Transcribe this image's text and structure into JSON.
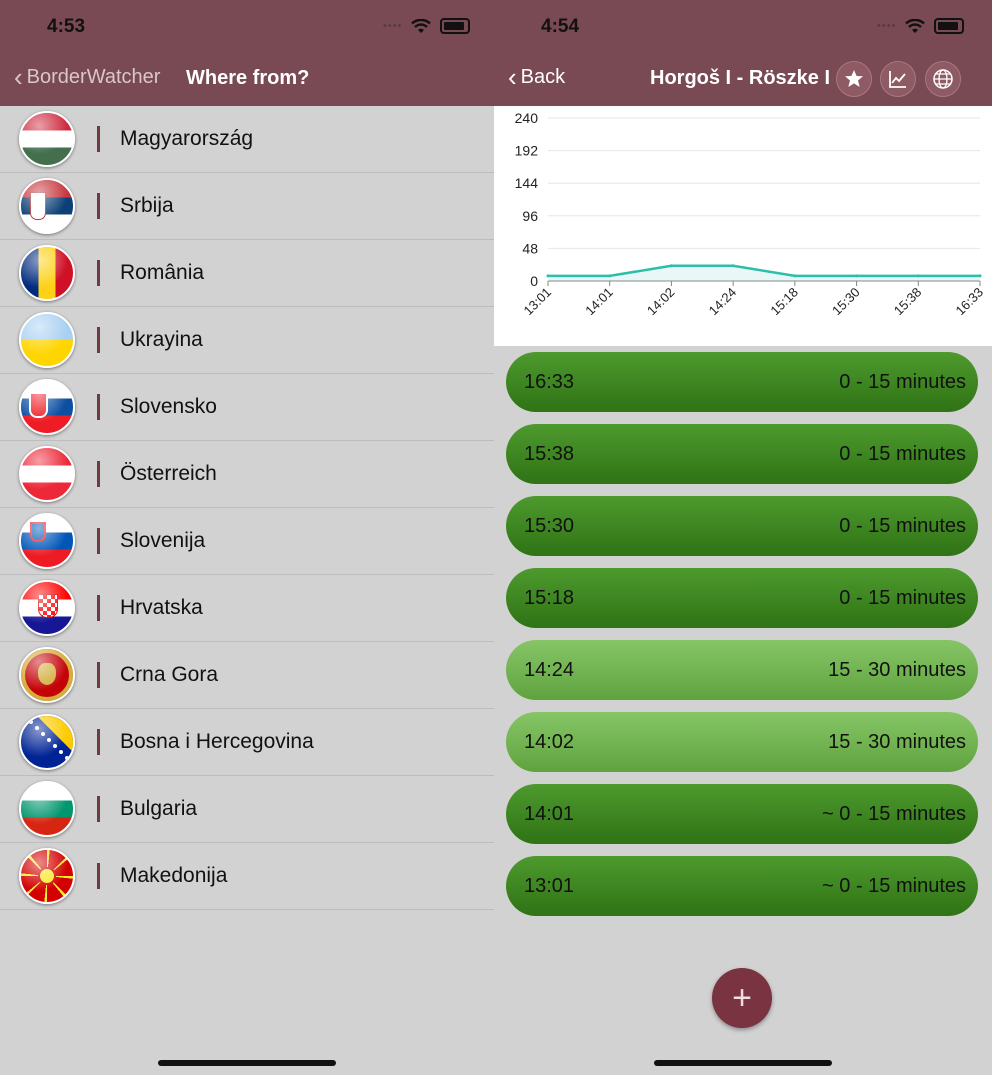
{
  "left": {
    "status_time": "4:53",
    "back_label": "BorderWatcher",
    "title": "Where from?",
    "countries": [
      {
        "name": "Magyarország",
        "flag": "hungary-flag"
      },
      {
        "name": "Srbija",
        "flag": "serbia-flag"
      },
      {
        "name": "România",
        "flag": "romania-flag"
      },
      {
        "name": "Ukrayina",
        "flag": "ukraine-flag"
      },
      {
        "name": "Slovensko",
        "flag": "slovakia-flag"
      },
      {
        "name": "Österreich",
        "flag": "austria-flag"
      },
      {
        "name": "Slovenija",
        "flag": "slovenia-flag"
      },
      {
        "name": "Hrvatska",
        "flag": "croatia-flag"
      },
      {
        "name": "Crna Gora",
        "flag": "montenegro-flag"
      },
      {
        "name": "Bosna i Hercegovina",
        "flag": "bosnia-flag"
      },
      {
        "name": "Bulgaria",
        "flag": "bulgaria-flag"
      },
      {
        "name": "Makedonija",
        "flag": "macedonia-flag"
      }
    ]
  },
  "right": {
    "status_time": "4:54",
    "back_label": "Back",
    "title": "Horgoš I - Röszke I",
    "icons": [
      "star-icon",
      "chart-icon",
      "globe-icon"
    ],
    "entries": [
      {
        "time": "16:33",
        "wait": "0 - 15 minutes",
        "style": "dark"
      },
      {
        "time": "15:38",
        "wait": "0 - 15 minutes",
        "style": "dark"
      },
      {
        "time": "15:30",
        "wait": "0 - 15 minutes",
        "style": "dark"
      },
      {
        "time": "15:18",
        "wait": "0 - 15 minutes",
        "style": "dark"
      },
      {
        "time": "14:24",
        "wait": "15 - 30 minutes",
        "style": "light"
      },
      {
        "time": "14:02",
        "wait": "15 - 30 minutes",
        "style": "light"
      },
      {
        "time": "14:01",
        "wait": "~ 0 - 15 minutes",
        "style": "dark"
      },
      {
        "time": "13:01",
        "wait": "~ 0 - 15 minutes",
        "style": "dark"
      }
    ],
    "fab_label": "+"
  },
  "colors": {
    "navbar": "#7a4a54",
    "line": "#2bbfa9",
    "dark_pill": "#3d8420",
    "light_pill": "#74b654",
    "fab": "#7a3340"
  },
  "chart_data": {
    "type": "area",
    "categories": [
      "13:01",
      "14:01",
      "14:02",
      "14:24",
      "15:18",
      "15:30",
      "15:38",
      "16:33"
    ],
    "values": [
      7.5,
      7.5,
      22.5,
      22.5,
      7.5,
      7.5,
      7.5,
      7.5
    ],
    "title": "",
    "xlabel": "",
    "ylabel": "",
    "ylim": [
      0,
      240
    ],
    "yticks": [
      "0",
      "48",
      "96",
      "144",
      "192",
      "240"
    ],
    "grid": true
  }
}
